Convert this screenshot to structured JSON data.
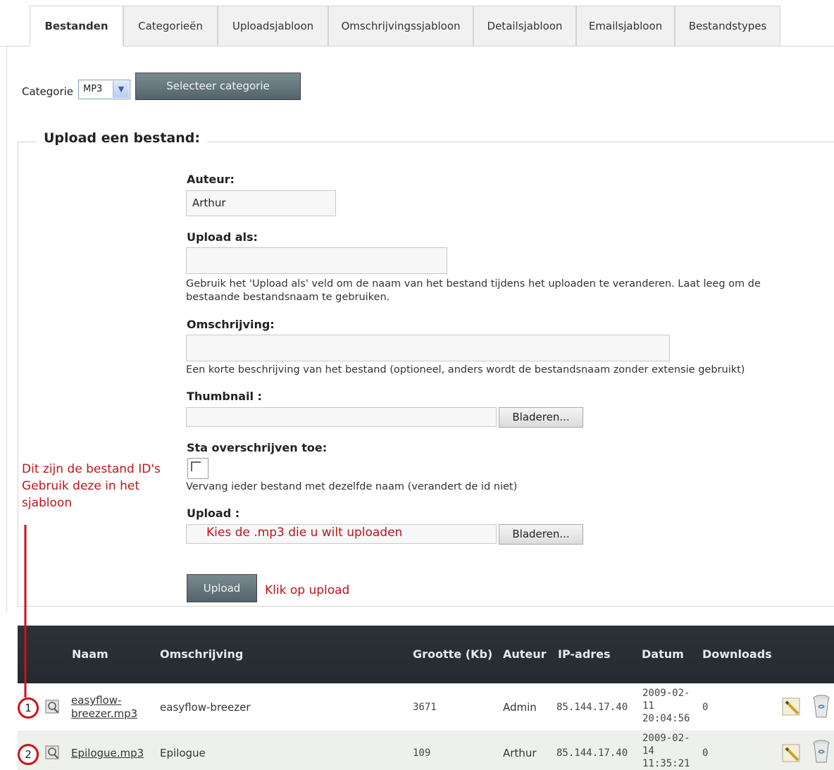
{
  "tabs": [
    "Bestanden",
    "Categorieën",
    "Uploadsjabloon",
    "Omschrijvingssjabloon",
    "Detailsjabloon",
    "Emailsjabloon",
    "Bestandstypes"
  ],
  "category": {
    "label": "Categorie",
    "value": "MP3",
    "button": "Selecteer categorie"
  },
  "form": {
    "legend": "Upload een bestand:",
    "author_label": "Auteur:",
    "author_value": "Arthur",
    "upload_as_label": "Upload als:",
    "upload_as_value": "",
    "upload_as_hint": "Gebruik het 'Upload als' veld om de naam van het bestand tijdens het uploaden te veranderen. Laat leeg om de bestaande bestandsnaam te gebruiken.",
    "description_label": "Omschrijving:",
    "description_value": "",
    "description_hint": "Een korte beschrijving van het bestand (optioneel, anders wordt de bestandsnaam zonder extensie gebruikt)",
    "thumbnail_label": "Thumbnail :",
    "thumbnail_value": "",
    "browse_label": "Bladeren...",
    "overwrite_label": "Sta overschrijven toe:",
    "overwrite_checked": false,
    "overwrite_hint": "Vervang ieder bestand met dezelfde naam (verandert de id niet)",
    "upload_label": "Upload :",
    "upload_button": "Upload"
  },
  "annotations": {
    "ids_note_1": "Dit zijn de bestand ID's",
    "ids_note_2": "Gebruik deze in het",
    "ids_note_3": "sjabloon",
    "choose_mp3": "Kies de .mp3 die u wilt uploaden",
    "click_upload": "Klik op upload",
    "color": "#c0141c"
  },
  "table": {
    "headers": {
      "name": "Naam",
      "description": "Omschrijving",
      "size": "Grootte (Kb)",
      "author": "Auteur",
      "ip": "IP-adres",
      "date": "Datum",
      "downloads": "Downloads"
    },
    "rows": [
      {
        "id": "1",
        "name_1": "easyflow-",
        "name_2": "breezer.mp3",
        "description": "easyflow-breezer",
        "size": "3671",
        "author": "Admin",
        "ip": "85.144.17.40",
        "date_1": "2009-02-",
        "date_2": "11",
        "date_3": "20:04:56",
        "downloads": "0"
      },
      {
        "id": "2",
        "name": "Epilogue.mp3",
        "description": "Epilogue",
        "size": "109",
        "author": "Arthur",
        "ip": "85.144.17.40",
        "date_1": "2009-02-",
        "date_2": "14",
        "date_3": "11:35:21",
        "downloads": "0"
      }
    ],
    "icons": [
      "view-icon",
      "edit-icon",
      "delete-icon"
    ]
  }
}
